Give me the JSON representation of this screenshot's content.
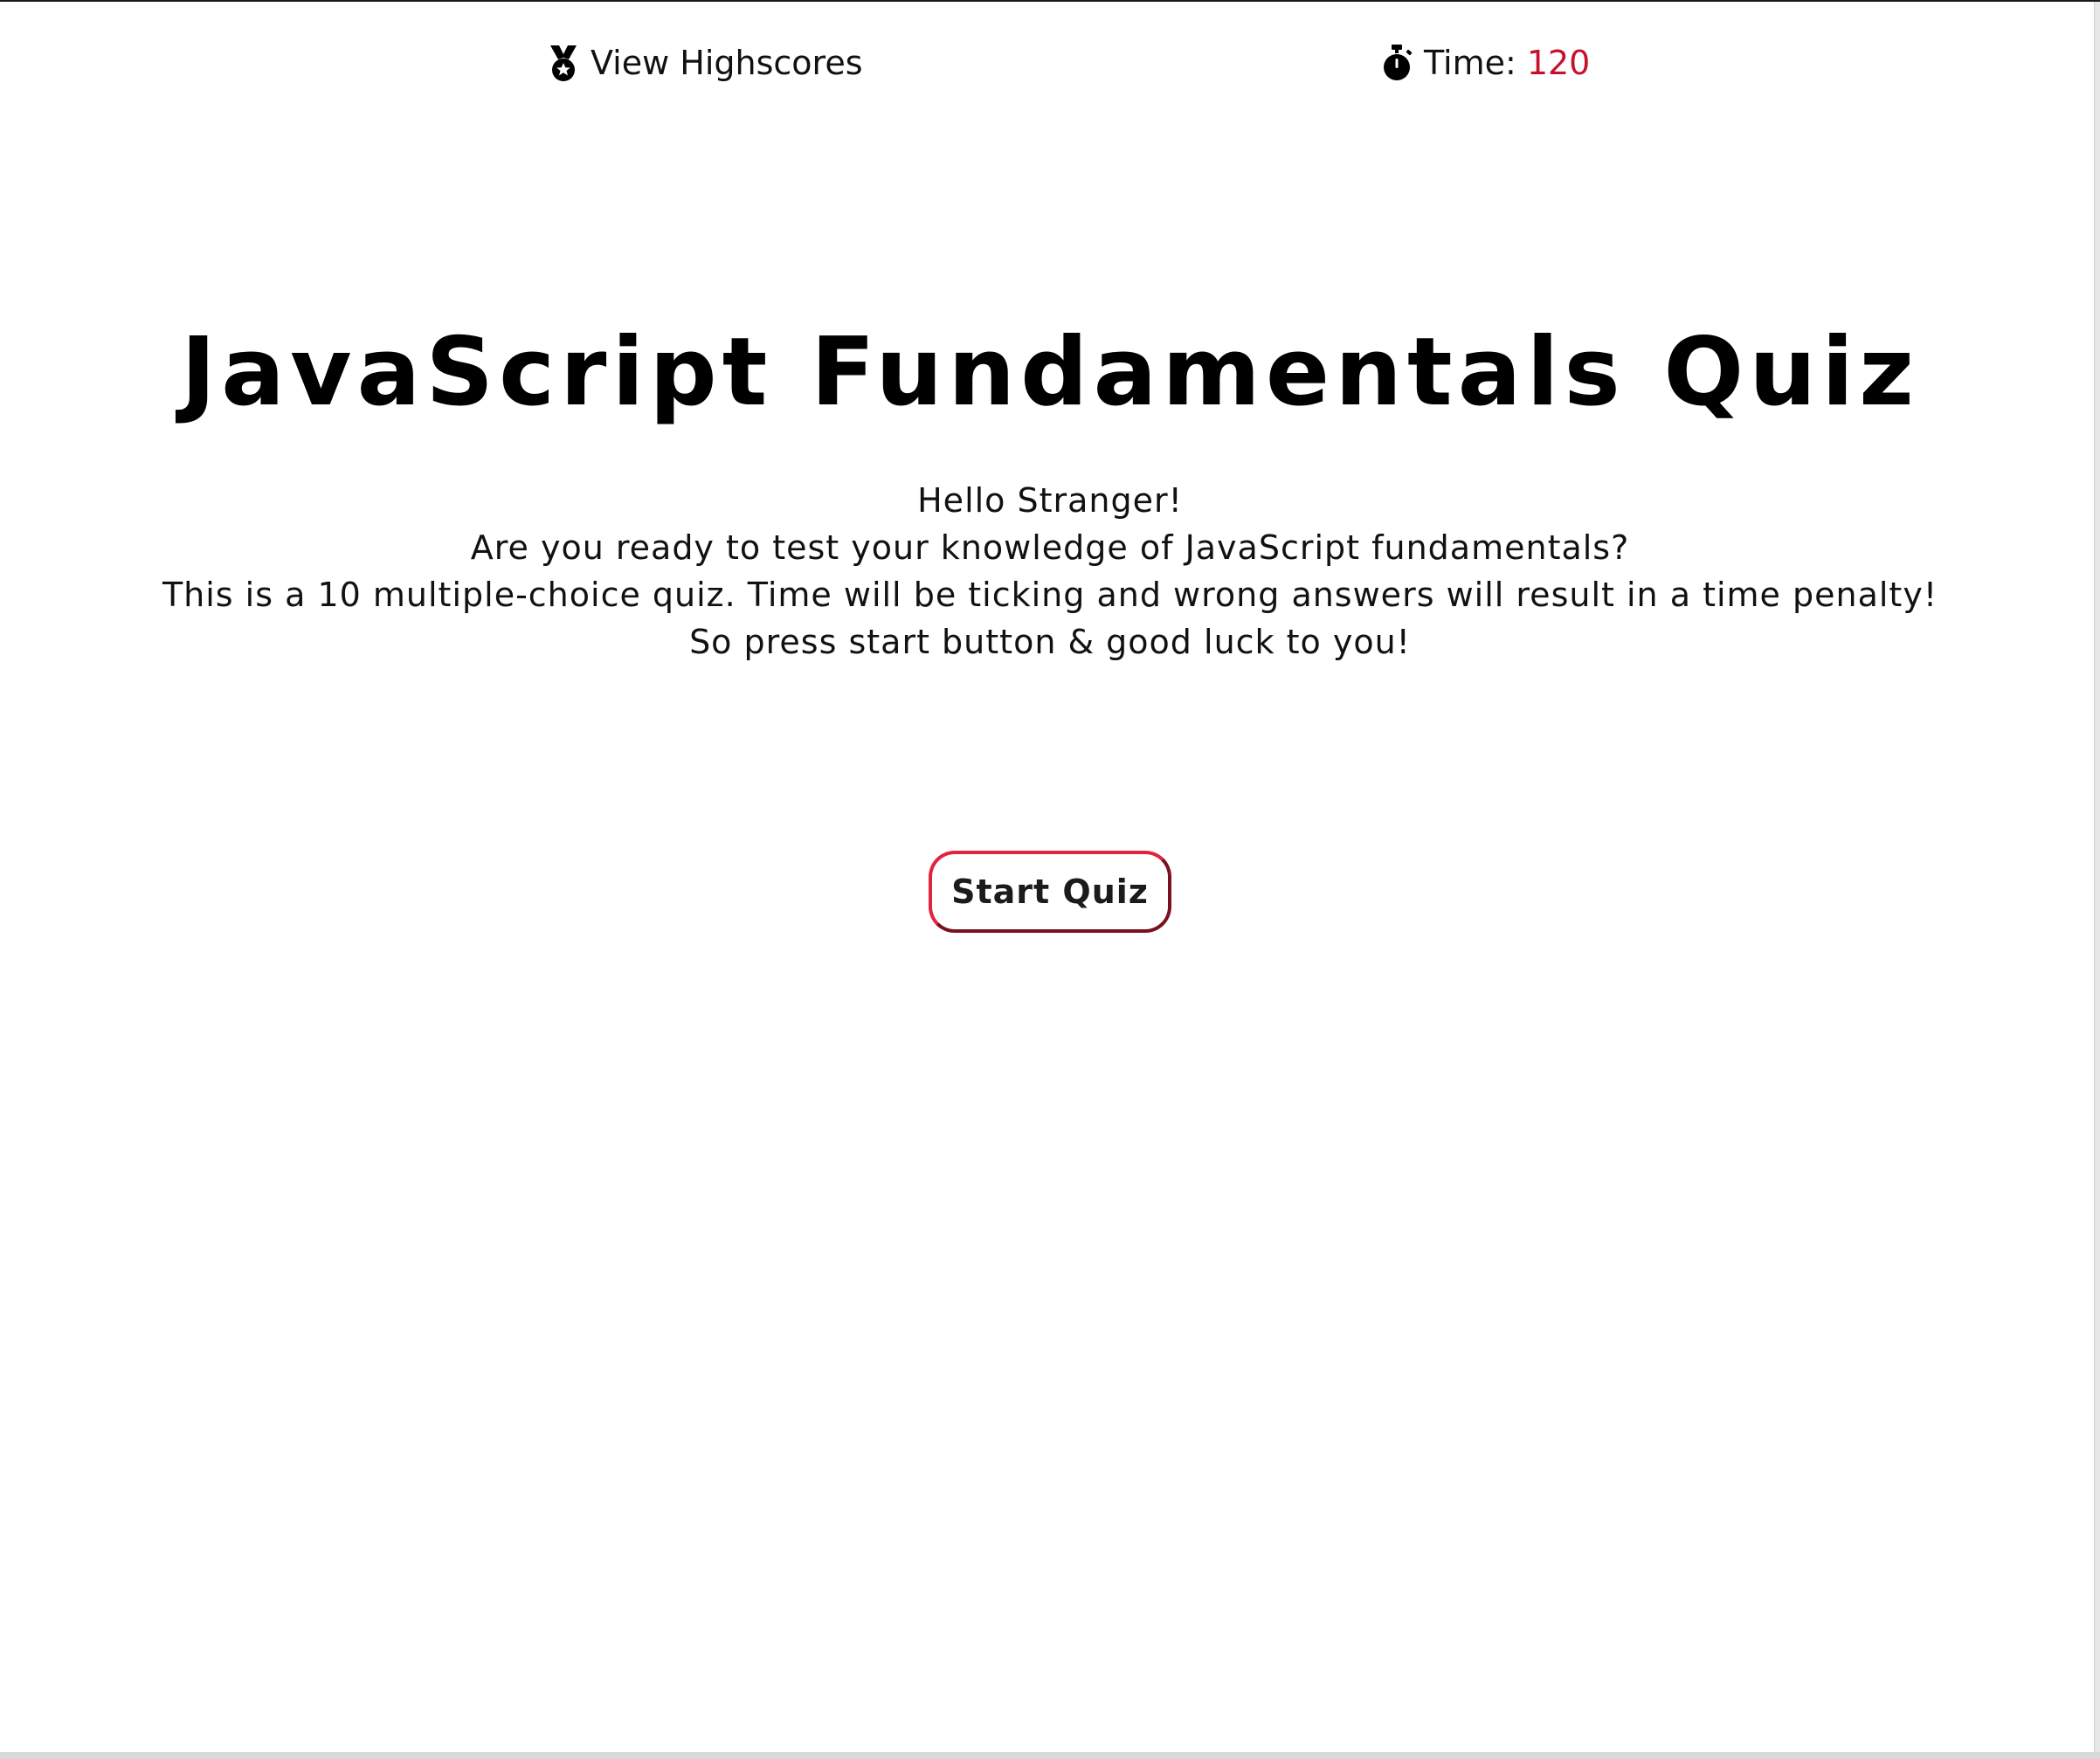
{
  "nav": {
    "highscores": {
      "icon": "medal-icon",
      "label": "View Highscores"
    },
    "timer": {
      "icon": "stopwatch-icon",
      "label": "Time:",
      "value": "120"
    }
  },
  "main": {
    "title": "JavaScript Fundamentals Quiz",
    "intro_lines": [
      "Hello Stranger!",
      "Are you ready to test your knowledge of JavaScript fundamentals?",
      "This is a 10 multiple-choice quiz. Time will be ticking and wrong answers will result in a time penalty!",
      "So press start button & good luck to you!"
    ],
    "start_button_label": "Start Quiz"
  },
  "colors": {
    "accent": "#c8102e",
    "button_border": "#e02440",
    "text": "#111111",
    "background": "#ffffff"
  }
}
